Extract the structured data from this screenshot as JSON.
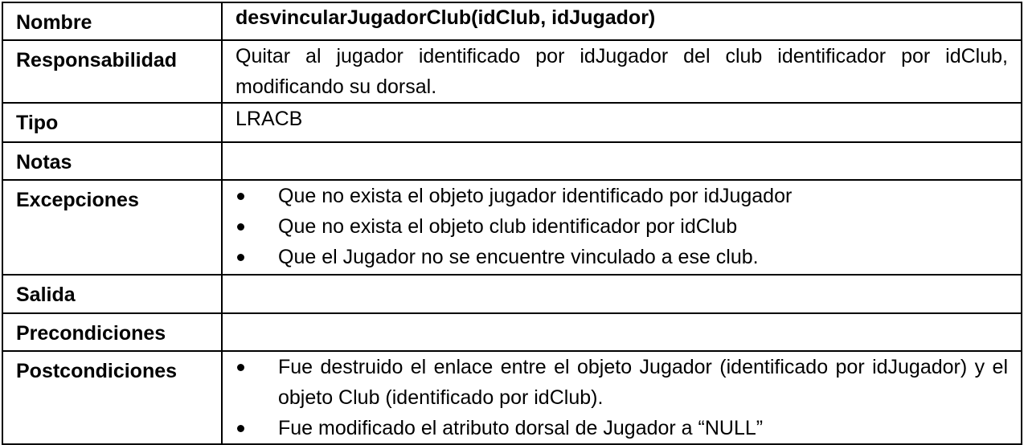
{
  "rows": {
    "nombre": {
      "label": "Nombre",
      "value": "desvincularJugadorClub(idClub, idJugador)"
    },
    "responsabilidad": {
      "label": "Responsabilidad",
      "value": "Quitar al jugador identificado por idJugador del club identificador por idClub, modificando su dorsal."
    },
    "tipo": {
      "label": "Tipo",
      "value": "LRACB"
    },
    "notas": {
      "label": "Notas",
      "value": ""
    },
    "excepciones": {
      "label": "Excepciones",
      "items": [
        "Que no exista el objeto jugador identificado por idJugador",
        "Que no exista el objeto club identificador por idClub",
        "Que el Jugador no se encuentre vinculado a ese club."
      ]
    },
    "salida": {
      "label": "Salida",
      "value": ""
    },
    "precondiciones": {
      "label": "Precondiciones",
      "value": ""
    },
    "postcondiciones": {
      "label": "Postcondiciones",
      "items": [
        "Fue destruido el enlace entre el objeto Jugador (identificado por idJugador) y el objeto Club (identificado por idClub).",
        "Fue modificado el atributo dorsal de Jugador a “NULL”"
      ]
    }
  }
}
